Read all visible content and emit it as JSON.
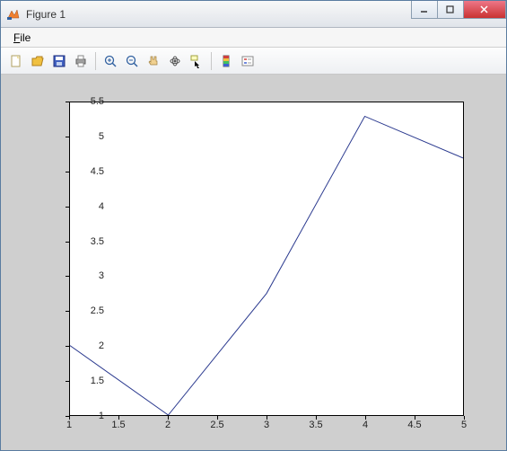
{
  "window": {
    "title": "Figure 1"
  },
  "menu": {
    "file": "File"
  },
  "toolbar": {
    "new": "New Figure",
    "open": "Open",
    "save": "Save",
    "print": "Print",
    "zoom_in": "Zoom In",
    "zoom_out": "Zoom Out",
    "pan": "Pan",
    "rotate": "Rotate 3D",
    "data_cursor": "Data Cursor",
    "insert_colorbar": "Insert Colorbar",
    "insert_legend": "Insert Legend"
  },
  "chart_data": {
    "type": "line",
    "x": [
      1,
      2,
      3,
      4,
      5
    ],
    "y": [
      2.0,
      1.0,
      2.75,
      5.3,
      4.7
    ],
    "xlim": [
      1,
      5
    ],
    "ylim": [
      1,
      5.5
    ],
    "xticks": [
      1,
      1.5,
      2,
      2.5,
      3,
      3.5,
      4,
      4.5,
      5
    ],
    "yticks": [
      1,
      1.5,
      2,
      2.5,
      3,
      3.5,
      4,
      4.5,
      5,
      5.5
    ],
    "xtick_labels": [
      "1",
      "1.5",
      "2",
      "2.5",
      "3",
      "3.5",
      "4",
      "4.5",
      "5"
    ],
    "ytick_labels": [
      "1",
      "1.5",
      "2",
      "2.5",
      "3",
      "3.5",
      "4",
      "4.5",
      "5",
      "5.5"
    ],
    "line_color": "#2b3a8f",
    "title": "",
    "xlabel": "",
    "ylabel": ""
  }
}
